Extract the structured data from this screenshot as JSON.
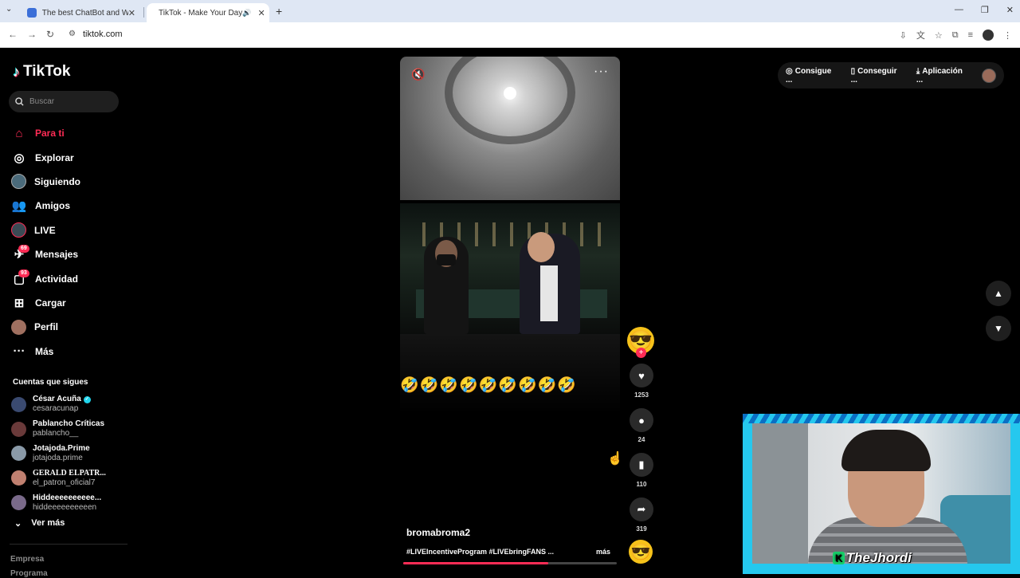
{
  "browser": {
    "tabs": [
      {
        "title": "The best ChatBot and Widgets",
        "active": false
      },
      {
        "title": "TikTok - Make Your Day",
        "active": true
      }
    ],
    "url": "tiktok.com"
  },
  "brand": {
    "name": "TikTok"
  },
  "search": {
    "placeholder": "Buscar"
  },
  "nav": {
    "items": [
      {
        "label": "Para ti",
        "icon": "home-icon",
        "active": true
      },
      {
        "label": "Explorar",
        "icon": "compass-icon"
      },
      {
        "label": "Siguiendo",
        "icon": "following-avatar"
      },
      {
        "label": "Amigos",
        "icon": "friends-icon"
      },
      {
        "label": "LIVE",
        "icon": "live-avatar"
      },
      {
        "label": "Mensajes",
        "icon": "messages-icon",
        "badge": "69"
      },
      {
        "label": "Actividad",
        "icon": "activity-icon",
        "badge": "93"
      },
      {
        "label": "Cargar",
        "icon": "upload-icon"
      },
      {
        "label": "Perfil",
        "icon": "profile-avatar"
      },
      {
        "label": "Más",
        "icon": "more-icon"
      }
    ]
  },
  "following": {
    "title": "Cuentas que sigues",
    "accounts": [
      {
        "name": "César Acuña",
        "username": "cesaracunap",
        "verified": true
      },
      {
        "name": "Pablancho Críticas",
        "username": "pablancho__"
      },
      {
        "name": "Jotajoda.Prime",
        "username": "jotajoda.prime"
      },
      {
        "name": "GERALD ELPATR...",
        "username": "el_patron_oficial7"
      },
      {
        "name": "Hiddeeeeeeeeee...",
        "username": "hiddeeeeeeeeeen"
      }
    ],
    "see_more": "Ver más"
  },
  "footer": {
    "company": "Empresa",
    "programs": "Programa"
  },
  "video": {
    "author": "bromabroma2",
    "description": "#LIVEIncentiveProgram #LIVEbringFANS ...",
    "more_label": "más",
    "emoji_caption": "🤣🤣🤣🤣🤣🤣🤣🤣🤣",
    "progress": 0.68
  },
  "actions": {
    "likes": "1253",
    "comments": "24",
    "saves": "110",
    "shares": "319"
  },
  "topbar": {
    "coins": "Consigue ...",
    "get_app": "Conseguir ...",
    "download": "Aplicación ..."
  },
  "streamer": {
    "name": "TheJhordi",
    "prefix": "K"
  },
  "colors": {
    "accent": "#fe2c55",
    "webcam_border": "#25c8ee"
  }
}
